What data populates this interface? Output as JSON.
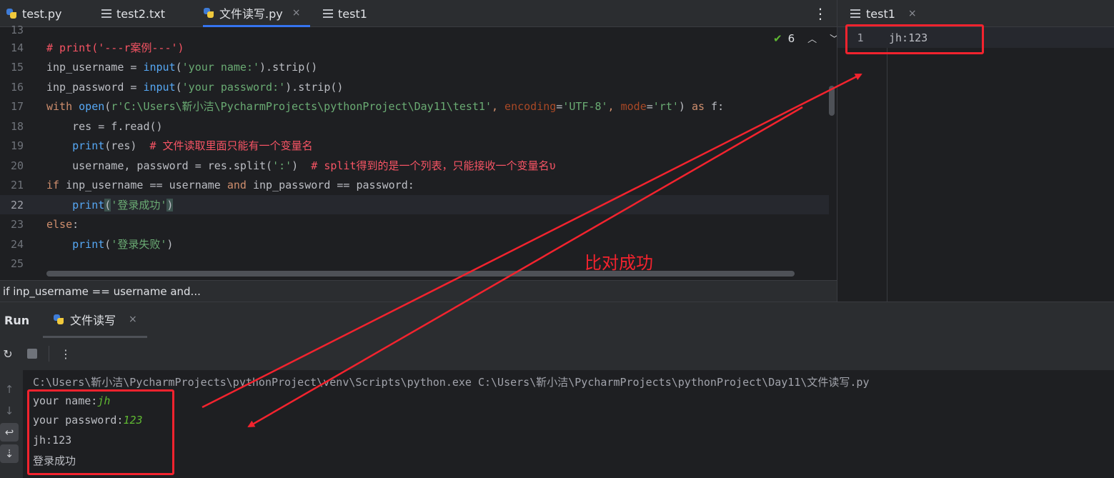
{
  "editor": {
    "tabs": [
      {
        "label": "test.py",
        "icon": "python-file-icon"
      },
      {
        "label": "test2.txt",
        "icon": "text-file-icon"
      },
      {
        "label": "文件读写.py",
        "icon": "python-file-icon",
        "active": true
      },
      {
        "label": "test1",
        "icon": "text-file-icon"
      }
    ],
    "close_glyph": "×",
    "more_glyph": "⋮",
    "partial_line_number": "13",
    "lines": [
      {
        "n": "14"
      },
      {
        "n": "15"
      },
      {
        "n": "16"
      },
      {
        "n": "17"
      },
      {
        "n": "18"
      },
      {
        "n": "19"
      },
      {
        "n": "20"
      },
      {
        "n": "21"
      },
      {
        "n": "22"
      },
      {
        "n": "23"
      },
      {
        "n": "24"
      },
      {
        "n": "25"
      }
    ],
    "code": {
      "l14": "# print('---r案例---')",
      "l15a": "inp_username = ",
      "l15b": "input",
      "l15c": "(",
      "l15d": "'your name:'",
      "l15e": ").strip()",
      "l16a": "inp_password = ",
      "l16b": "input",
      "l16c": "(",
      "l16d": "'your password:'",
      "l16e": ").strip()",
      "l17a": "with ",
      "l17b": "open",
      "l17c": "(",
      "l17d": "r'C:\\Users\\靳小洁\\PycharmProjects\\pythonProject\\Day11\\test1'",
      "l17e": ", ",
      "l17f": "encoding",
      "l17g": "=",
      "l17h": "'UTF-8'",
      "l17i": ", ",
      "l17j": "mode",
      "l17k": "=",
      "l17l": "'rt'",
      "l17m": ") ",
      "l17n": "as",
      "l17o": " f:",
      "l18": "    res = f.read()",
      "l19a": "    ",
      "l19b": "print",
      "l19c": "(res)  ",
      "l19d": "# 文件读取里面只能有一个变量名",
      "l20a": "    username, password = res.split(",
      "l20b": "':'",
      "l20c": ")  ",
      "l20d": "# split得到的是一个列表，只能接收一个变量名υ",
      "l21a": "if ",
      "l21b": "inp_username == username ",
      "l21c": "and",
      "l21d": " inp_password == password:",
      "l22a": "    ",
      "l22b": "print",
      "l22c": "(",
      "l22d": "'登录成功'",
      "l22e": ")",
      "l23a": "else",
      "l23b": ":",
      "l24a": "    ",
      "l24b": "print",
      "l24c": "(",
      "l24d": "'登录失败'",
      "l24e": ")"
    },
    "inspections": {
      "count": "6",
      "up": "^",
      "down": "v"
    },
    "breadcrumb": "if inp_username == username and..."
  },
  "right_editor": {
    "tab_label": "test1",
    "line_number": "1",
    "content": "jh:123"
  },
  "run": {
    "title": "Run",
    "tab_label": "文件读写",
    "console": {
      "command": "C:\\Users\\靳小洁\\PycharmProjects\\pythonProject\\venv\\Scripts\\python.exe C:\\Users\\靳小洁\\PycharmProjects\\pythonProject\\Day11\\文件读写.py",
      "prompt_name": "your name:",
      "input_name": "jh",
      "prompt_password": "your password:",
      "input_password": "123",
      "output_file": "jh:123",
      "output_result": "登录成功"
    }
  },
  "annotation": {
    "text": "比对成功",
    "color": "#f3232e"
  },
  "colors": {
    "keyword": "#cf8e6d",
    "function": "#56a8f5",
    "string": "#6aab73",
    "comment": "#f75464",
    "accent": "#3574f0"
  }
}
